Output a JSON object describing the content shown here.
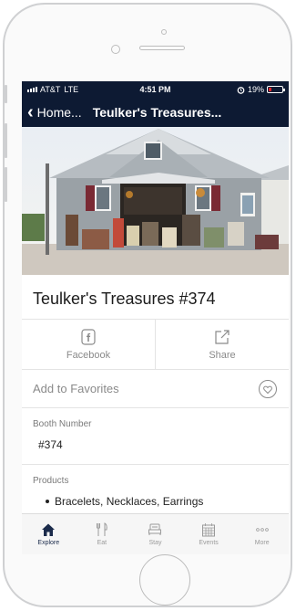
{
  "status_bar": {
    "carrier": "AT&T",
    "network": "LTE",
    "time": "4:51 PM",
    "battery": "19%",
    "battery_level": 0.19
  },
  "nav": {
    "back_label": "Home...",
    "title": "Teulker's Treasures..."
  },
  "vendor": {
    "name": "Teulker's Treasures #374"
  },
  "actions": {
    "facebook_label": "Facebook",
    "share_label": "Share"
  },
  "favorites": {
    "label": "Add to Favorites"
  },
  "booth": {
    "label": "Booth Number",
    "value": "#374"
  },
  "products": {
    "label": "Products",
    "items": [
      "Bracelets, Necklaces, Earrings"
    ]
  },
  "tabbar": {
    "items": [
      {
        "label": "Explore",
        "icon": "home-icon",
        "active": true
      },
      {
        "label": "Eat",
        "icon": "utensils-icon",
        "active": false
      },
      {
        "label": "Stay",
        "icon": "bed-icon",
        "active": false
      },
      {
        "label": "Events",
        "icon": "calendar-icon",
        "active": false
      },
      {
        "label": "More",
        "icon": "more-dots-icon",
        "active": false
      }
    ]
  },
  "colors": {
    "header_bg": "#0d1a33",
    "battery_low": "#e0242b",
    "tab_active": "#1b2b4b"
  }
}
